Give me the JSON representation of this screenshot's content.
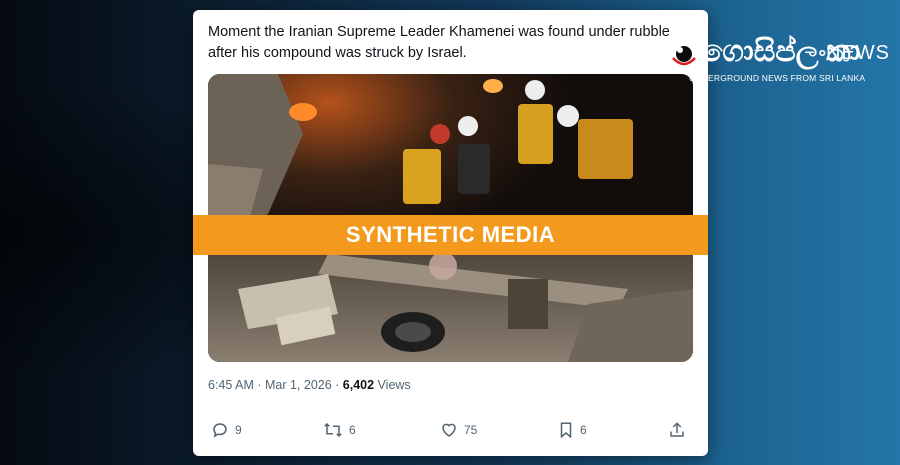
{
  "tweet": {
    "text": "Moment the Iranian Supreme Leader Khamenei was found under rubble after his compound was struck by Israel.",
    "banner_label": "SYNTHETIC MEDIA",
    "timestamp": "6:45 AM · Mar 1, 2026 · ",
    "views_count": "6,402",
    "views_label": " Views"
  },
  "actions": {
    "replies": "9",
    "reposts": "6",
    "likes": "75",
    "bookmarks": "6"
  },
  "logo": {
    "script_text": "ගොසිප්ලංකා",
    "news_text": "NEWS",
    "tagline": "UNDERGROUND NEWS FROM SRI LANKA"
  },
  "colors": {
    "banner": "#f39a1e",
    "text": "#0f1419",
    "muted": "#536471"
  },
  "icons": [
    "reply-icon",
    "repost-icon",
    "like-icon",
    "bookmark-icon",
    "share-icon",
    "logo-eye-icon"
  ]
}
